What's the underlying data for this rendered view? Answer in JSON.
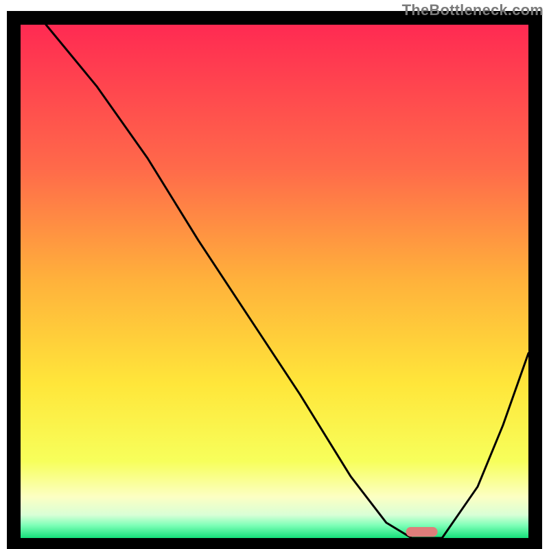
{
  "watermark": "TheBottleneck.com",
  "chart_data": {
    "type": "line",
    "title": "",
    "xlabel": "",
    "ylabel": "",
    "xlim": [
      0,
      100
    ],
    "ylim": [
      0,
      100
    ],
    "grid": false,
    "legend": false,
    "series": [
      {
        "name": "curve",
        "x": [
          5,
          15,
          25,
          35,
          45,
          55,
          60,
          65,
          72,
          77,
          83,
          90,
          95,
          100
        ],
        "values": [
          100,
          88,
          74,
          58,
          43,
          28,
          20,
          12,
          3,
          0,
          0,
          10,
          22,
          36
        ]
      }
    ],
    "marker": {
      "name": "optimal-point",
      "x": 79,
      "y": 1.2,
      "color": "#de7d7a"
    },
    "background_gradient": {
      "stops": [
        {
          "offset": 0.0,
          "color": "#ff2a52"
        },
        {
          "offset": 0.28,
          "color": "#ff6a4a"
        },
        {
          "offset": 0.5,
          "color": "#ffb23b"
        },
        {
          "offset": 0.7,
          "color": "#ffe63a"
        },
        {
          "offset": 0.85,
          "color": "#f7ff5b"
        },
        {
          "offset": 0.92,
          "color": "#fcffc3"
        },
        {
          "offset": 0.955,
          "color": "#d9ffd6"
        },
        {
          "offset": 0.975,
          "color": "#7fffb8"
        },
        {
          "offset": 1.0,
          "color": "#15e07a"
        }
      ]
    },
    "frame_color": "#000000",
    "curve_color": "#000000",
    "curve_width": 3
  }
}
